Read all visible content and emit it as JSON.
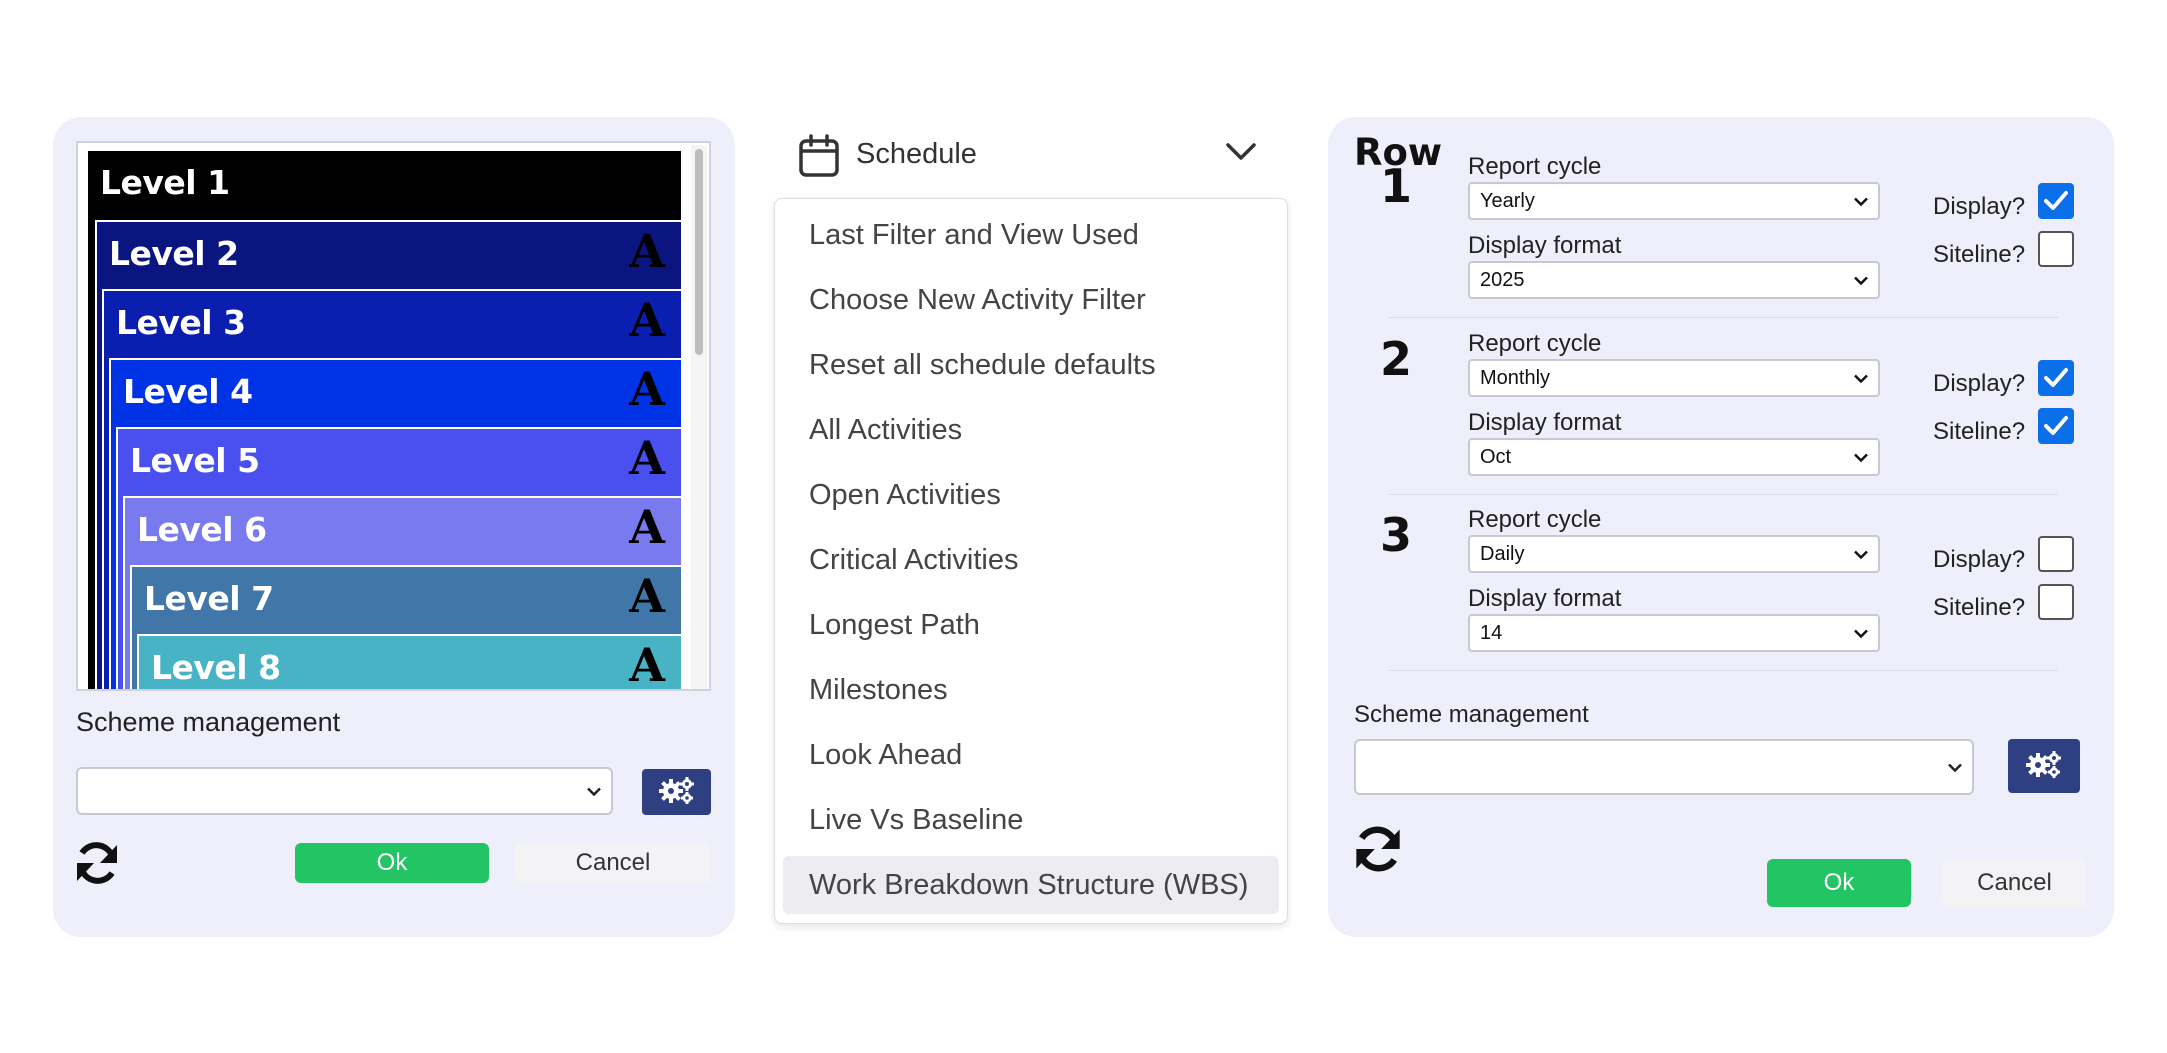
{
  "left_panel": {
    "levels": [
      {
        "label": "Level 1",
        "color": "#000000",
        "font_icon": ""
      },
      {
        "label": "Level 2",
        "color": "#0b1580",
        "font_icon": "A"
      },
      {
        "label": "Level 3",
        "color": "#0a1fb0",
        "font_icon": "A"
      },
      {
        "label": "Level 4",
        "color": "#0033e6",
        "font_icon": "A"
      },
      {
        "label": "Level 5",
        "color": "#4a4ff0",
        "font_icon": "A"
      },
      {
        "label": "Level 6",
        "color": "#7a7aef",
        "font_icon": "A"
      },
      {
        "label": "Level 7",
        "color": "#4176a8",
        "font_icon": "A"
      },
      {
        "label": "Level 8",
        "color": "#47b3c4",
        "font_icon": "A"
      }
    ],
    "scheme_management_label": "Scheme management",
    "scheme_value": "",
    "ok_label": "Ok",
    "cancel_label": "Cancel"
  },
  "schedule_menu": {
    "title": "Schedule",
    "items": [
      "Last Filter and View Used",
      "Choose New Activity Filter",
      "Reset all schedule defaults",
      "All Activities",
      "Open Activities",
      "Critical Activities",
      "Longest Path",
      "Milestones",
      "Look Ahead",
      "Live Vs Baseline",
      "Work Breakdown Structure (WBS)"
    ],
    "selected_index": 10
  },
  "right_panel": {
    "row_heading": "Row",
    "rows": [
      {
        "number": "1",
        "report_cycle_label": "Report cycle",
        "report_cycle": "Yearly",
        "display_format_label": "Display format",
        "display_format": "2025",
        "display_label": "Display?",
        "display": true,
        "siteline_label": "Siteline?",
        "siteline": false
      },
      {
        "number": "2",
        "report_cycle_label": "Report cycle",
        "report_cycle": "Monthly",
        "display_format_label": "Display format",
        "display_format": "Oct",
        "display_label": "Display?",
        "display": true,
        "siteline_label": "Siteline?",
        "siteline": true
      },
      {
        "number": "3",
        "report_cycle_label": "Report cycle",
        "report_cycle": "Daily",
        "display_format_label": "Display format",
        "display_format": "14",
        "display_label": "Display?",
        "display": false,
        "siteline_label": "Siteline?",
        "siteline": false
      }
    ],
    "scheme_management_label": "Scheme management",
    "scheme_value": "",
    "ok_label": "Ok",
    "cancel_label": "Cancel"
  },
  "colors": {
    "panel_bg": "#efeffb",
    "ok_green": "#22c464",
    "gear_button": "#2e3f82",
    "checkbox_blue": "#0a6fe8"
  },
  "icons": {
    "gear": "gears-icon",
    "refresh": "refresh-icon",
    "calendar": "calendar-icon",
    "dropdown": "chevron-down-icon"
  }
}
